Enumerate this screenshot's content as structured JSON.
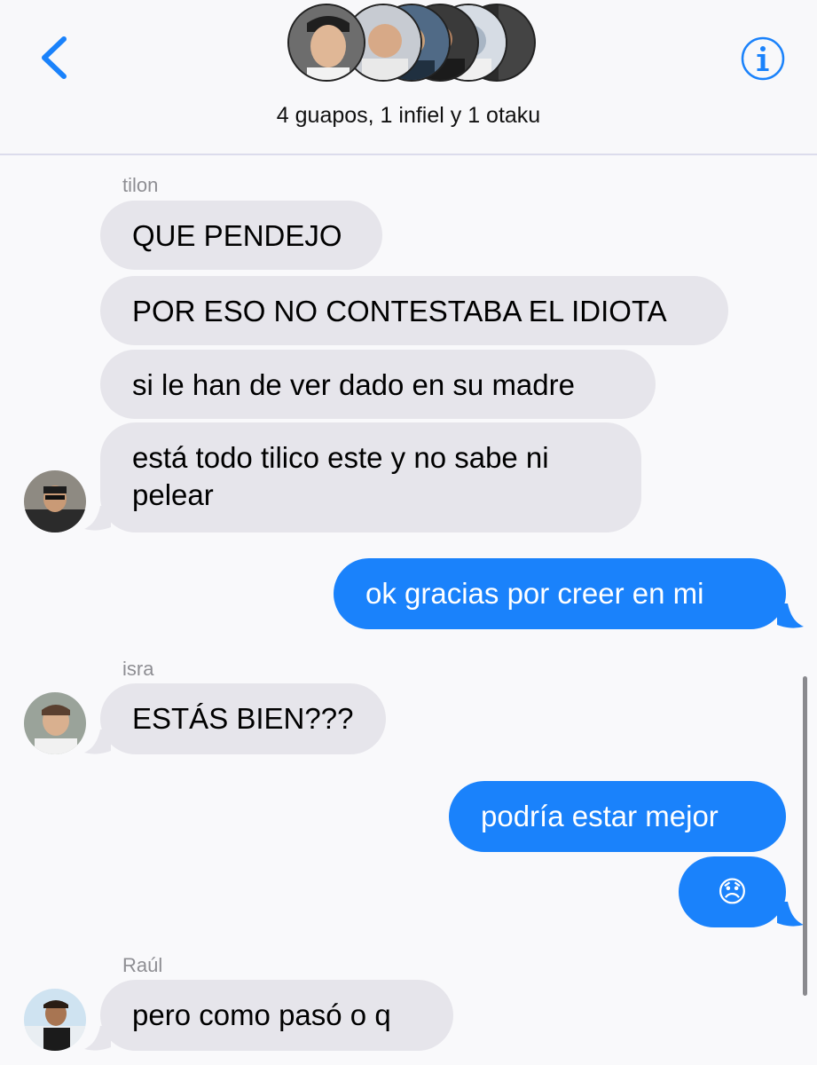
{
  "header": {
    "title": "4 guapos, 1 infiel y 1 otaku",
    "back_label": "Back",
    "info_icon": "info-icon"
  },
  "messages": [
    {
      "sender": "tilon",
      "direction": "incoming",
      "text": "QUE PENDEJO"
    },
    {
      "sender": "tilon",
      "direction": "incoming",
      "text": "POR ESO NO CONTESTABA EL IDIOTA"
    },
    {
      "sender": "tilon",
      "direction": "incoming",
      "text": "si le han de ver dado en su madre"
    },
    {
      "sender": "tilon",
      "direction": "incoming",
      "text_line1": "está todo tilico este y no sabe ni",
      "text_line2": "pelear"
    },
    {
      "direction": "outgoing",
      "text": "ok gracias por creer en mi"
    },
    {
      "sender": "isra",
      "direction": "incoming",
      "text": "ESTÁS BIEN???"
    },
    {
      "direction": "outgoing",
      "text": "podría estar mejor"
    },
    {
      "direction": "outgoing",
      "text": "😞"
    },
    {
      "sender": "Raúl",
      "direction": "incoming",
      "text": "pero como pasó o q"
    }
  ],
  "senders": {
    "tilon": "tilon",
    "isra": "isra",
    "raul": "Raúl"
  },
  "colors": {
    "incoming_bubble": "#e6e5eb",
    "outgoing_bubble": "#1a82fb",
    "accent": "#1a82fb"
  }
}
